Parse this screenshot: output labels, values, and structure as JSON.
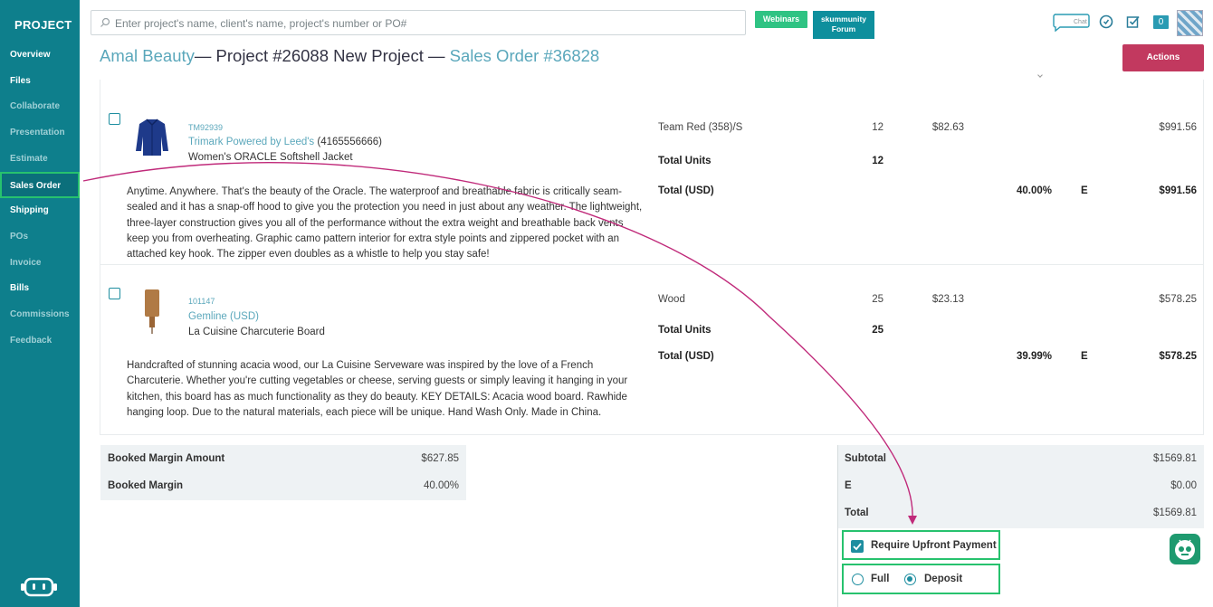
{
  "sidebar": {
    "brand": "PROJECT",
    "items": [
      {
        "label": "Overview"
      },
      {
        "label": "Files"
      },
      {
        "label": "Collaborate"
      },
      {
        "label": "Presentation"
      },
      {
        "label": "Estimate"
      },
      {
        "label": "Sales Order"
      },
      {
        "label": "Shipping"
      },
      {
        "label": "POs"
      },
      {
        "label": "Invoice"
      },
      {
        "label": "Bills"
      },
      {
        "label": "Commissions"
      },
      {
        "label": "Feedback"
      }
    ]
  },
  "topbar": {
    "search_placeholder": "Enter project's name, client's name, project's number or PO#",
    "webinars_label": "Webinars",
    "forum_line1": "skummunity",
    "forum_line2": "Forum",
    "chat_label": "Chat",
    "notification_count": "0"
  },
  "header": {
    "client": "Amal Beauty",
    "project": "— Project #26088 New Project —",
    "order": "Sales Order #36828",
    "actions_label": "Actions"
  },
  "items": [
    {
      "sku": "TM92939",
      "supplier": "Trimark Powered by Leed's",
      "phone": "(4165556666)",
      "name": "Women's ORACLE Softshell Jacket",
      "description": "Anytime. Anywhere. That's the beauty of the Oracle. The waterproof and breathable fabric is critically seam-sealed and it has a snap-off hood to give you the protection you need in just about any weather. The lightweight, three-layer construction gives you all of the performance without the extra weight and breathable back vents keep you from overheating. Graphic camo pattern interior for extra style points and zippered pocket with an attached key hook. The zipper even doubles as a whistle to help you stay safe!",
      "variant": "Team Red (358)/S",
      "qty": "12",
      "unit_price": "$82.63",
      "line_total": "$991.56",
      "total_units_label": "Total Units",
      "total_units": "12",
      "total_label": "Total (USD)",
      "margin": "40.00%",
      "tax": "E",
      "total": "$991.56"
    },
    {
      "sku": "101147",
      "supplier": "Gemline (USD)",
      "phone": "",
      "name": "La Cuisine Charcuterie Board",
      "description": "Handcrafted of stunning acacia wood, our La Cuisine Serveware was inspired by the love of a French Charcuterie. Whether you're cutting vegetables or cheese, serving guests or simply leaving it hanging in your kitchen, this board has as much functionality as they do beauty. KEY DETAILS: Acacia wood board. Rawhide hanging loop. Due to the natural materials, each piece will be unique. Hand Wash Only. Made in China.",
      "variant": "Wood",
      "qty": "25",
      "unit_price": "$23.13",
      "line_total": "$578.25",
      "total_units_label": "Total Units",
      "total_units": "25",
      "total_label": "Total (USD)",
      "margin": "39.99%",
      "tax": "E",
      "total": "$578.25"
    }
  ],
  "margin_summary": {
    "booked_amount_label": "Booked Margin Amount",
    "booked_amount": "$627.85",
    "booked_margin_label": "Booked Margin",
    "booked_margin": "40.00%"
  },
  "totals": {
    "subtotal_label": "Subtotal",
    "subtotal": "$1569.81",
    "tax_label": "E",
    "tax": "$0.00",
    "total_label": "Total",
    "total": "$1569.81"
  },
  "payment": {
    "require_upfront_label": "Require Upfront Payment",
    "require_upfront_checked": true,
    "full_label": "Full",
    "deposit_label": "Deposit",
    "selected": "Deposit"
  },
  "colors": {
    "sidebar": "#0e7f8c",
    "highlight": "#27c26e",
    "actions": "#c2395f",
    "link": "#5aa7bb",
    "annotation_arrow": "#c02a7a"
  }
}
